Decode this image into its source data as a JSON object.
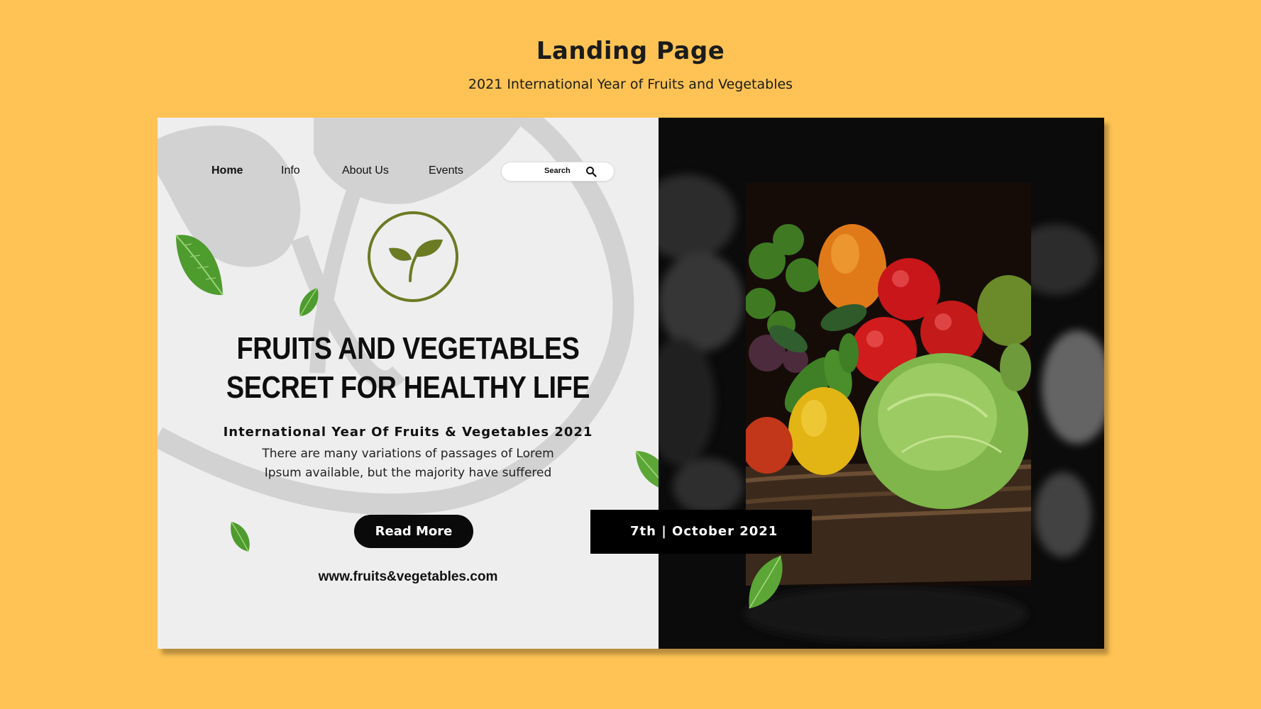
{
  "header": {
    "title": "Landing Page",
    "subtitle": "2021 International Year of Fruits and Vegetables"
  },
  "nav": {
    "items": [
      "Home",
      "Info",
      "About Us",
      "Events"
    ],
    "active": "Home",
    "search_label": "Search"
  },
  "hero": {
    "headline_line1": "FRUITS AND VEGETABLES",
    "headline_line2": "SECRET FOR HEALTHY LIFE",
    "intl_year": "International Year Of Fruits & Vegetables 2021",
    "body_line1": "There are many variations of passages of Lorem",
    "body_line2": "Ipsum available, but the majority have suffered",
    "cta_label": "Read More",
    "website": "www.fruits&vegetables.com"
  },
  "event": {
    "date": "7th |  October 2021"
  },
  "colors": {
    "background": "#FEC354",
    "panel_light": "#EEEEEF",
    "panel_dark": "#0b0b0b",
    "logo_green": "#6B7B23",
    "button": "#0a0a0a"
  },
  "icons": {
    "search": "search-icon",
    "logo": "sprout-icon",
    "decor": "mint-leaf-icon"
  }
}
